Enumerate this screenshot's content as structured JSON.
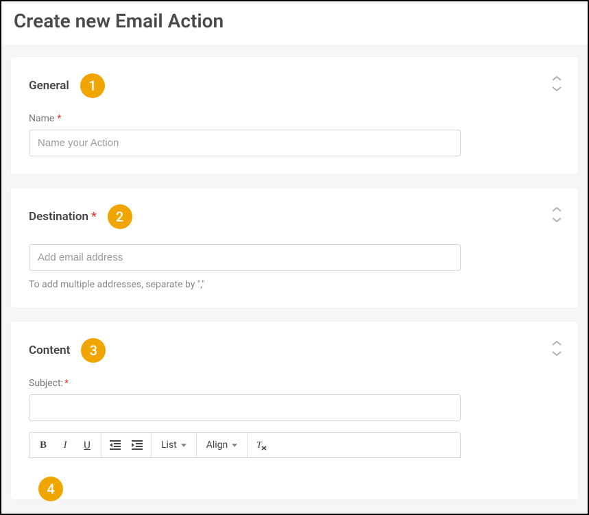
{
  "page_title": "Create new Email Action",
  "badges": {
    "b1": "1",
    "b2": "2",
    "b3": "3",
    "b4": "4"
  },
  "general": {
    "title": "General",
    "name_label": "Name",
    "name_required": "*",
    "name_placeholder": "Name your Action",
    "name_value": ""
  },
  "destination": {
    "title": "Destination",
    "title_required": "*",
    "email_placeholder": "Add email address",
    "email_value": "",
    "helper": "To add multiple addresses, separate by \",\""
  },
  "content": {
    "title": "Content",
    "subject_label": "Subject:",
    "subject_required": "*",
    "subject_value": "",
    "toolbar": {
      "list_label": "List",
      "align_label": "Align"
    }
  }
}
